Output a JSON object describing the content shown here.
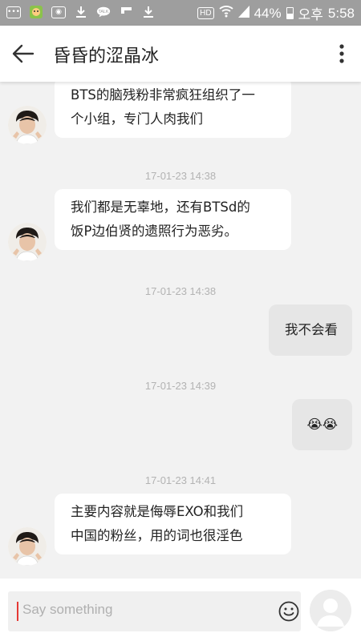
{
  "status_bar": {
    "battery": "44%",
    "ampm": "오후",
    "time": "5:58",
    "hd": "HD"
  },
  "header": {
    "title": "昏昏的涩晶冰"
  },
  "messages": [
    {
      "type": "incoming",
      "lines": [
        "BTS的脑残粉非常疯狂组织了一",
        "个小组，专门人肉我们"
      ]
    },
    {
      "type": "timestamp",
      "text": "17-01-23 14:38"
    },
    {
      "type": "incoming",
      "lines": [
        "我们都是无辜地，还有BTSd的",
        "饭P边伯贤的遗照行为恶劣。"
      ]
    },
    {
      "type": "timestamp",
      "text": "17-01-23 14:38"
    },
    {
      "type": "outgoing",
      "text": "我不会看"
    },
    {
      "type": "timestamp",
      "text": "17-01-23 14:39"
    },
    {
      "type": "outgoing",
      "text": "😭😭"
    },
    {
      "type": "timestamp",
      "text": "17-01-23 14:41"
    },
    {
      "type": "incoming",
      "lines": [
        "主要内容就是侮辱EXO和我们",
        "中国的粉丝，用的词也很淫色"
      ]
    }
  ],
  "input": {
    "placeholder": "Say something"
  },
  "colors": {
    "status_bar": "#9e9e9e",
    "background": "#f2f2f2",
    "incoming_bubble": "#ffffff",
    "outgoing_bubble": "#e6e6e6",
    "cursor": "#e53935"
  }
}
